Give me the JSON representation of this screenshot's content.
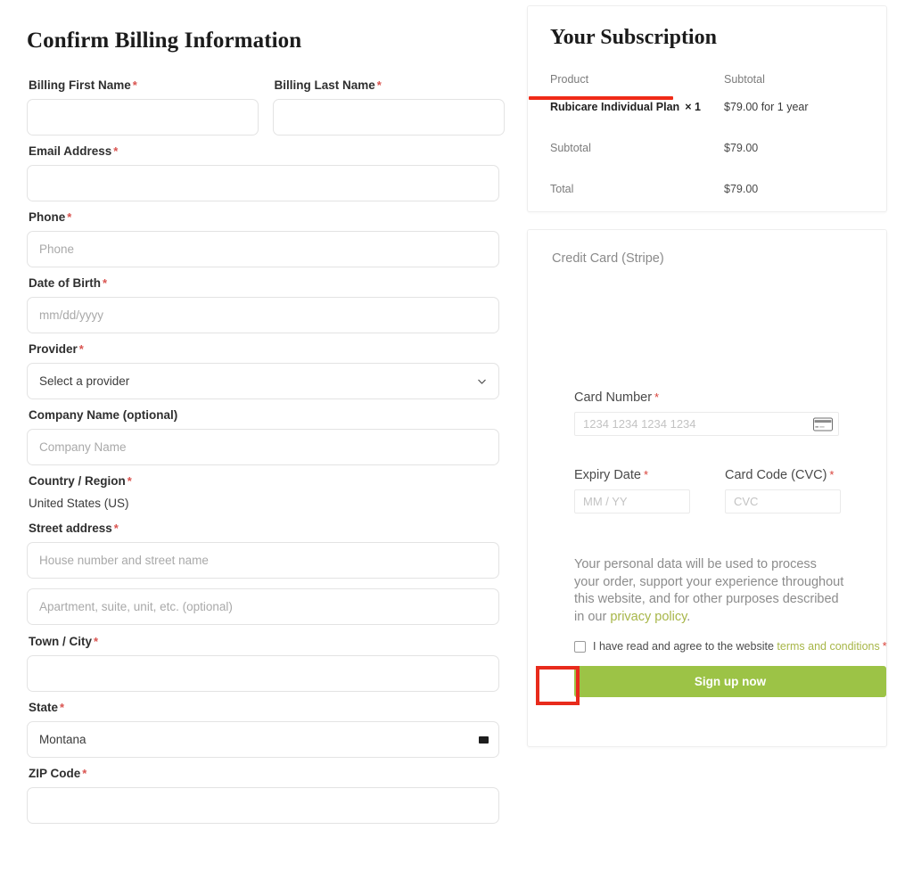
{
  "billing": {
    "title": "Confirm Billing Information",
    "fields": {
      "first_name": {
        "label": "Billing First Name",
        "value": "",
        "placeholder": ""
      },
      "last_name": {
        "label": "Billing Last Name",
        "value": "",
        "placeholder": ""
      },
      "email": {
        "label": "Email Address",
        "value": "",
        "placeholder": ""
      },
      "phone": {
        "label": "Phone",
        "value": "",
        "placeholder": "Phone"
      },
      "dob": {
        "label": "Date of Birth",
        "value": "",
        "placeholder": "mm/dd/yyyy"
      },
      "provider": {
        "label": "Provider",
        "selected": "Select a provider"
      },
      "company": {
        "label": "Company Name (optional)",
        "value": "",
        "placeholder": "Company Name"
      },
      "country": {
        "label": "Country / Region",
        "value": "United States (US)"
      },
      "street": {
        "label": "Street address",
        "value": "",
        "placeholder": "House number and street name"
      },
      "apartment": {
        "label": "",
        "value": "",
        "placeholder": "Apartment, suite, unit, etc. (optional)"
      },
      "city": {
        "label": "Town / City",
        "value": "",
        "placeholder": ""
      },
      "state": {
        "label": "State",
        "selected": "Montana"
      },
      "zip": {
        "label": "ZIP Code",
        "value": "",
        "placeholder": ""
      }
    },
    "required_marker": "*"
  },
  "subscription": {
    "title": "Your Subscription",
    "columns": {
      "product": "Product",
      "subtotal": "Subtotal"
    },
    "line_item": {
      "name": "Rubicare Individual Plan",
      "quantity": "× 1",
      "price": "$79.00 for 1 year"
    },
    "subtotal": {
      "label": "Subtotal",
      "value": "$79.00"
    },
    "total": {
      "label": "Total",
      "value": "$79.00"
    }
  },
  "payment": {
    "gateway_title": "Credit Card (Stripe)",
    "card_number": {
      "label": "Card Number",
      "placeholder": "1234 1234 1234 1234",
      "value": ""
    },
    "expiry": {
      "label": "Expiry Date",
      "placeholder": "MM / YY",
      "value": ""
    },
    "cvc": {
      "label": "Card Code (CVC)",
      "placeholder": "CVC",
      "value": ""
    },
    "required_marker": "*",
    "privacy_text": "Your personal data will be used to process your order, support your experience throughout this website, and for other purposes described in our ",
    "privacy_link": "privacy policy",
    "privacy_period": ".",
    "terms_prefix": "I have read and agree to the website ",
    "terms_link": "terms and conditions",
    "terms_required": "*",
    "submit_label": "Sign up now"
  },
  "colors": {
    "required_red": "#d9534f",
    "link_green": "#a7b648",
    "button_green": "#9cc346",
    "annotation_red": "#e82b1c",
    "underline_red": "#f02a17"
  }
}
